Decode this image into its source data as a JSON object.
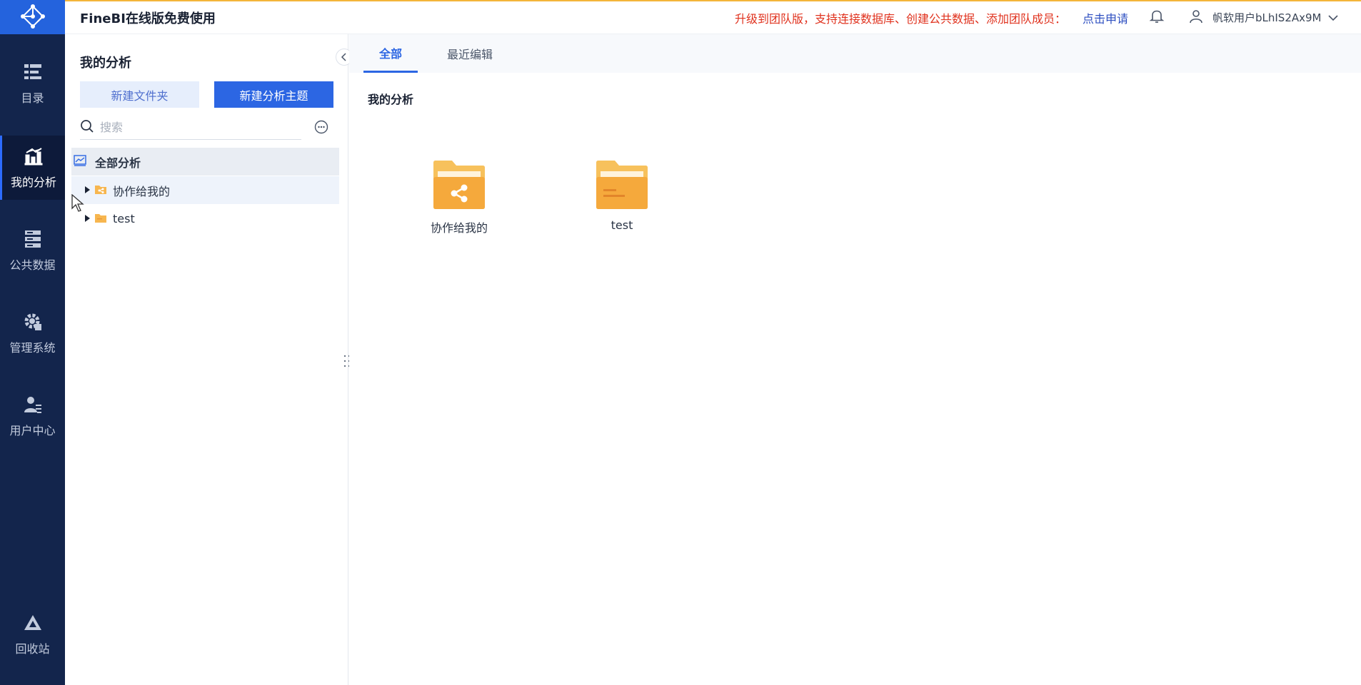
{
  "app": {
    "title": "FineBI在线版免费使用",
    "upgrade_text": "升级到团队版，支持连接数据库、创建公共数据、添加团队成员：",
    "apply_link": "点击申请",
    "username": "帆软用户bLhIS2Ax9M"
  },
  "colors": {
    "nav_bg": "#13254c",
    "accent": "#2c66e3",
    "upgrade_red": "#e0321e",
    "folder_yellow": "#f7b64f"
  },
  "nav": {
    "items": [
      {
        "label": "目录",
        "icon": "catalog-icon"
      },
      {
        "label": "我的分析",
        "icon": "analysis-chart-icon",
        "active": true
      },
      {
        "label": "公共数据",
        "icon": "database-icon"
      },
      {
        "label": "管理系统",
        "icon": "gear-icon"
      },
      {
        "label": "用户中心",
        "icon": "user-center-icon"
      }
    ],
    "recycle": {
      "label": "回收站",
      "icon": "recycle-icon"
    }
  },
  "panel": {
    "title": "我的分析",
    "new_folder": "新建文件夹",
    "new_topic": "新建分析主题",
    "search_placeholder": "搜索",
    "tree": [
      {
        "label": "全部分析",
        "icon": "analysis-root-icon"
      },
      {
        "label": "协作给我的",
        "icon": "shared-folder-icon"
      },
      {
        "label": "test",
        "icon": "folder-icon"
      }
    ]
  },
  "main": {
    "tabs": [
      {
        "label": "全部",
        "active": true
      },
      {
        "label": "最近编辑"
      }
    ],
    "section_title": "我的分析",
    "cards": [
      {
        "label": "协作给我的",
        "icon": "shared-folder-icon"
      },
      {
        "label": "test",
        "icon": "folder-icon"
      }
    ]
  }
}
